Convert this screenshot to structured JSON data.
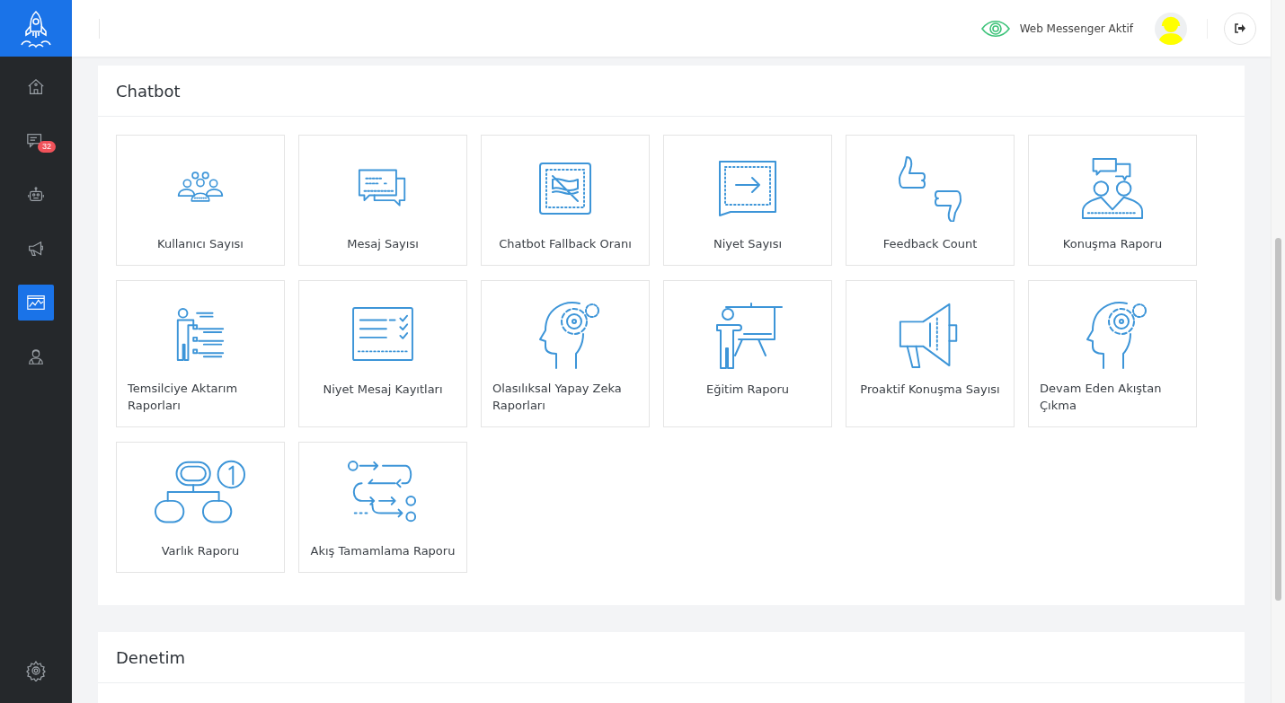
{
  "sidebar": {
    "nav_items": [
      {
        "selected": false
      },
      {
        "selected": false,
        "badge": "32"
      },
      {
        "selected": false
      },
      {
        "selected": false
      },
      {
        "selected": true
      },
      {
        "selected": false
      }
    ]
  },
  "header": {
    "status": "Web Messenger Aktif"
  },
  "sections": [
    {
      "title": "Chatbot",
      "tiles": [
        {
          "label": "Kullanıcı Sayısı"
        },
        {
          "label": "Mesaj Sayısı"
        },
        {
          "label": "Chatbot Fallback Oranı"
        },
        {
          "label": "Niyet Sayısı"
        },
        {
          "label": "Feedback Count"
        },
        {
          "label": "Konuşma Raporu"
        },
        {
          "label": "Temsilciye Aktarım Raporları"
        },
        {
          "label": "Niyet Mesaj Kayıtları"
        },
        {
          "label": "Olasılıksal Yapay Zeka Raporları"
        },
        {
          "label": "Eğitim Raporu"
        },
        {
          "label": "Proaktif Konuşma Sayısı"
        },
        {
          "label": "Devam Eden Akıştan Çıkma"
        },
        {
          "label": "Varlık Raporu"
        },
        {
          "label": "Akış Tamamlama Raporu"
        }
      ]
    },
    {
      "title": "Denetim"
    }
  ]
}
